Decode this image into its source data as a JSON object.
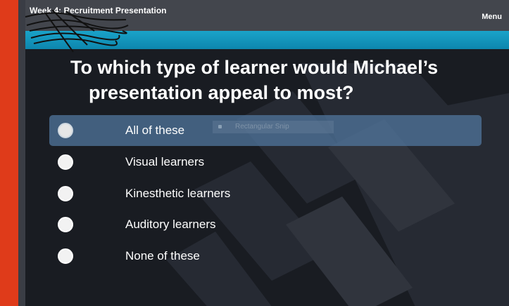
{
  "header": {
    "title": "Week 4: Recruitment Presentation",
    "menu_label": "Menu"
  },
  "colors": {
    "left_strip": "#df3b1a",
    "accent_bar": "#1aa3c9",
    "selected_option": "#50769e"
  },
  "question": {
    "line1": "To which type of learner would Michael’s",
    "line2": "presentation appeal to most?"
  },
  "options": [
    {
      "label": "All of these",
      "selected": true
    },
    {
      "label": "Visual learners",
      "selected": false
    },
    {
      "label": "Kinesthetic learners",
      "selected": false
    },
    {
      "label": "Auditory learners",
      "selected": false
    },
    {
      "label": "None of these",
      "selected": false
    }
  ],
  "tooltip": {
    "text": "Rectangular Snip"
  }
}
